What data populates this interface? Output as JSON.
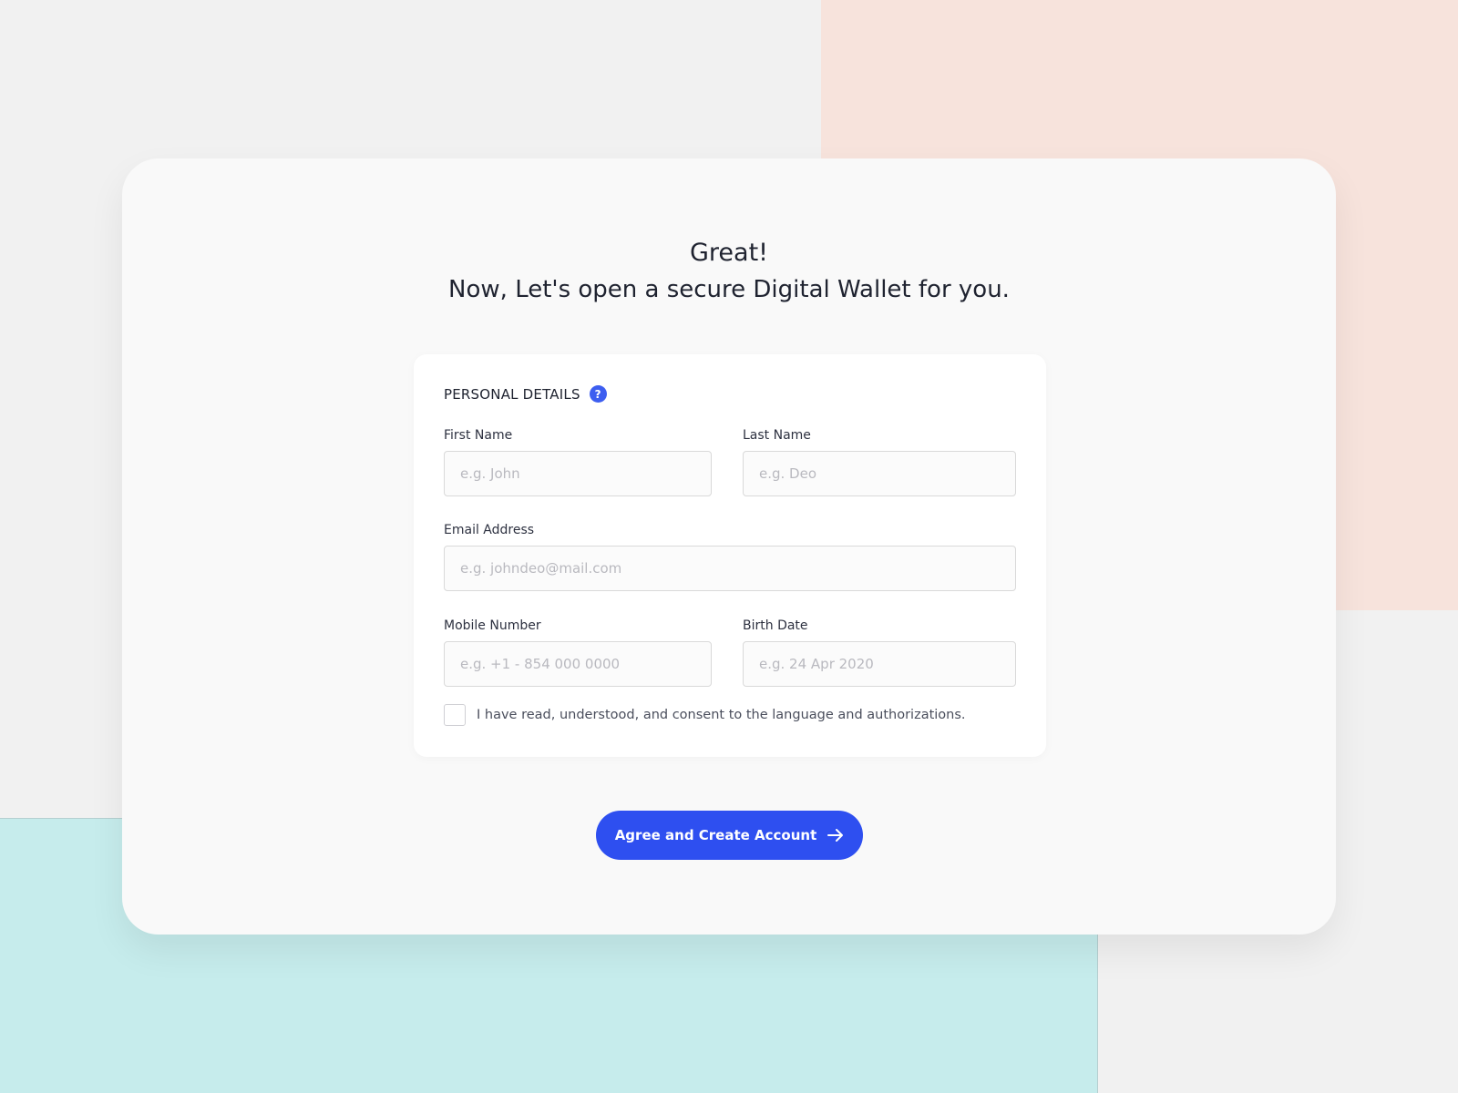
{
  "heading": {
    "line1": "Great!",
    "line2": "Now, Let's open a secure Digital Wallet for you."
  },
  "form": {
    "section_title": "PERSONAL DETAILS",
    "help_icon": "?",
    "first_name": {
      "label": "First Name",
      "placeholder": "e.g. John",
      "value": ""
    },
    "last_name": {
      "label": "Last Name",
      "placeholder": "e.g. Deo",
      "value": ""
    },
    "email": {
      "label": "Email Address",
      "placeholder": "e.g. johndeo@mail.com",
      "value": ""
    },
    "mobile": {
      "label": "Mobile Number",
      "placeholder": "e.g. +1 - 854 000 0000",
      "value": ""
    },
    "birth_date": {
      "label": "Birth Date",
      "placeholder": "e.g. 24 Apr 2020",
      "value": ""
    },
    "consent": {
      "checked": false,
      "text": "I have read, understood, and consent to the language and authorizations."
    }
  },
  "cta": {
    "label": "Agree and Create Account",
    "icon": "arrow-right-icon"
  },
  "colors": {
    "accent": "#2e4ff0",
    "help_icon": "#3d5ef0",
    "background": "#f1f1f1",
    "peach_panel": "#f7e3dc",
    "teal_panel": "#c6ecec"
  }
}
